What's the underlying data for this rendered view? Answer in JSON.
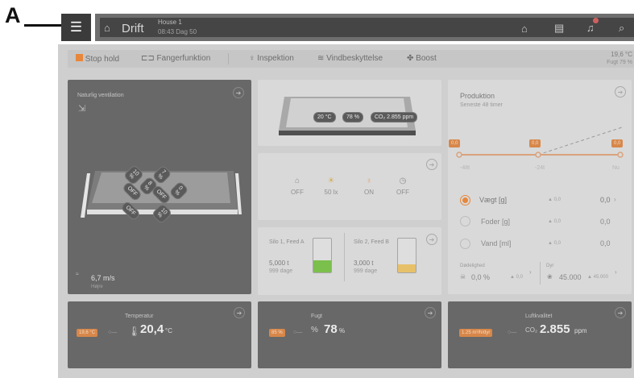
{
  "callout": {
    "label": "A"
  },
  "header": {
    "menu_icon": "hamburger-icon",
    "title": "Drift",
    "house": "House 1",
    "time": "08:43  Dag 50",
    "notification_count": ""
  },
  "actions": {
    "stop": "Stop hold",
    "fanger": "Fangerfunktion",
    "inspektion": "Inspektion",
    "vind": "Vindbeskyttelse",
    "boost": "Boost",
    "temp": "19,6 °C",
    "fugt": "Fugt 79 %"
  },
  "ventilation": {
    "title": "Naturlig ventilation",
    "wind": "6,7 m/s",
    "wind_dir": "Højre",
    "tags": [
      "10 %",
      "7 %",
      "OFF",
      "8 %",
      "OFF",
      "0 %",
      "OFF",
      "10 %"
    ]
  },
  "house_card": {
    "temp": "20 °C",
    "hum": "78 %",
    "co2": "CO₂ 2.855 ppm"
  },
  "status_icons": [
    {
      "label": "OFF",
      "icon": "fan-icon"
    },
    {
      "label": "50 lx",
      "icon": "bulb-icon"
    },
    {
      "label": "ON",
      "icon": "drop-icon"
    },
    {
      "label": "OFF",
      "icon": "timer-icon"
    }
  ],
  "silos": [
    {
      "name": "Silo 1, Feed A",
      "amount": "5,000 t",
      "days": "999 dage",
      "fill": 0.35,
      "color": "#7bbf4c"
    },
    {
      "name": "Silo 2, Feed B",
      "amount": "3,000 t",
      "days": "999 dage",
      "fill": 0.25,
      "color": "#e7c06a"
    }
  ],
  "produktion": {
    "title": "Produktion",
    "subtitle": "Seneste 48 timer",
    "x_labels": [
      "-48t",
      "-24t",
      "Nu"
    ],
    "markers": [
      "0,0",
      "0,0",
      "0,0"
    ],
    "rows": [
      {
        "label": "Vægt [g]",
        "delta": "▲ 0,0",
        "value": "0,0",
        "selected": true
      },
      {
        "label": "Foder [g]",
        "delta": "▲ 0,0",
        "value": "0,0",
        "selected": false
      },
      {
        "label": "Vand [ml]",
        "delta": "▲ 0,0",
        "value": "0,0",
        "selected": false
      }
    ],
    "dead_label": "Dødelighed",
    "dead_value": "0,0 %",
    "dead_delta": "▲ 0,0",
    "dyr_label": "Dyr",
    "dyr_value": "45.000",
    "dyr_delta": "▲ 45.000"
  },
  "tiles": [
    {
      "title": "Temperatur",
      "pill": "19,6 °C",
      "value": "20,4",
      "unit": "°C"
    },
    {
      "title": "Fugt",
      "pill": "85 %",
      "value": "78",
      "unit": "%"
    },
    {
      "title": "Luftkvalitet",
      "pill": "1.25 m³/h/dyr",
      "value": "2.855",
      "unit": "ppm",
      "prefix": "CO₂"
    }
  ],
  "colors": {
    "accent": "#e7873c",
    "dark_card": "#686868",
    "light_card": "#d9d9d9"
  }
}
